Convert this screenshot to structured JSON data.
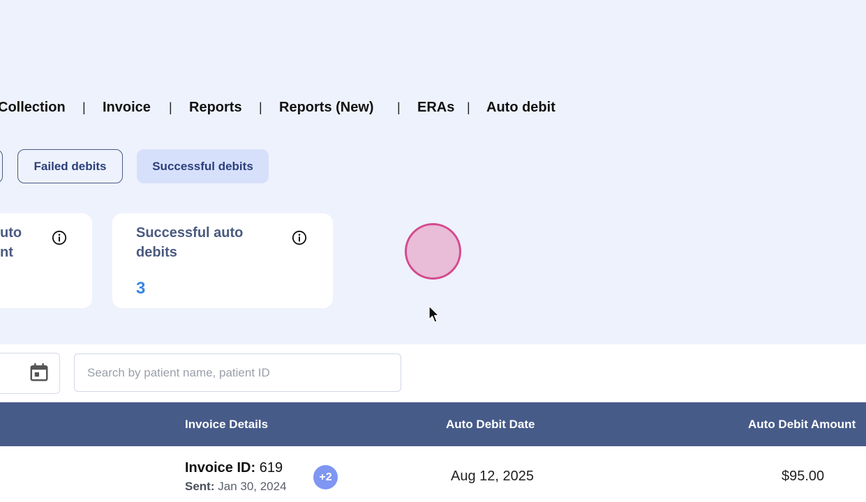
{
  "nav": {
    "items": [
      "Collection",
      "Invoice",
      "Reports",
      "Reports (New)",
      "ERAs",
      "Auto debit"
    ],
    "separator": "|"
  },
  "filters": {
    "failed_label": "Failed debits",
    "successful_label": "Successful debits",
    "active": "Successful debits"
  },
  "cards": {
    "partial": {
      "title_line1": "uto",
      "title_line2": "nt"
    },
    "successful": {
      "title_line1": "Successful auto",
      "title_line2": "debits",
      "value": "3"
    }
  },
  "search": {
    "placeholder": "Search by patient name, patient ID",
    "value": ""
  },
  "table": {
    "columns": [
      "Invoice Details",
      "Auto Debit Date",
      "Auto Debit Amount"
    ],
    "rows": [
      {
        "invoice_id_label": "Invoice ID:",
        "invoice_id": "619",
        "sent_label": "Sent:",
        "sent_date": "Jan 30, 2024",
        "extra_badge": "+2",
        "auto_debit_date": "Aug 12, 2025",
        "auto_debit_amount": "$95.00"
      }
    ]
  },
  "icons": {
    "info": "info-icon",
    "calendar": "calendar-icon",
    "cursor": "mouse-cursor-icon"
  },
  "colors": {
    "accent": "#3a86e0",
    "header": "#475b89",
    "badge": "#7f96f2",
    "highlight": "#d44a8e"
  }
}
